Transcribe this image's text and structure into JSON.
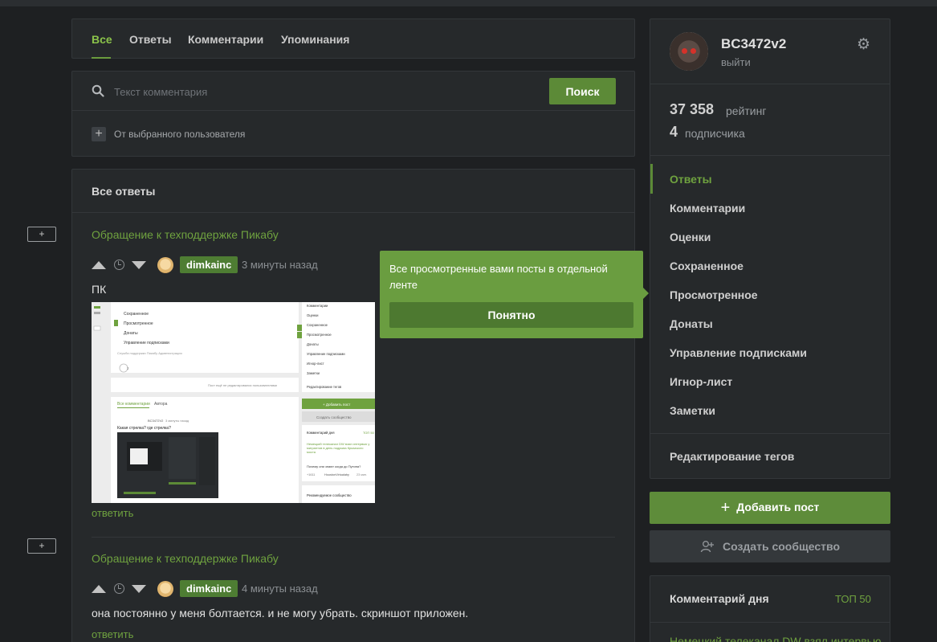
{
  "tabs": [
    {
      "label": "Все",
      "active": true
    },
    {
      "label": "Ответы"
    },
    {
      "label": "Комментарии"
    },
    {
      "label": "Упоминания"
    }
  ],
  "search": {
    "placeholder": "Текст комментария",
    "button": "Поиск",
    "from_user": "От выбранного пользователя"
  },
  "answers": {
    "heading": "Все ответы",
    "items": [
      {
        "title": "Обращение к техподдержке Пикабу",
        "user": "dimkainc",
        "time": "3 минуты назад",
        "text": "ПК",
        "has_image": true,
        "reply": "ответить"
      },
      {
        "title": "Обращение к техподдержке Пикабу",
        "user": "dimkainc",
        "time": "4 минуты назад",
        "text": "она постоянно у меня болтается. и не могу убрать. скриншот приложен.",
        "reply": "ответить"
      }
    ],
    "collapse_label": "+"
  },
  "screenshot_text": {
    "left_menu": [
      "Сохраненное",
      "Просмотренное",
      "Донаты",
      "Управление подписками"
    ],
    "footer": "Служба поддержки    Пикабу    Администрация",
    "count": "2",
    "not_edited": "Пост ещё не редактировался пользователями",
    "tabs": [
      "Все комментарии",
      "Автора"
    ],
    "user": "BC3472V2",
    "time": "3 минуты назад",
    "question": "Какая стрелка? где стрелка?",
    "right_menu": [
      "Комментарии",
      "Оценки",
      "Сохраненное",
      "Просмотренное",
      "Донаты",
      "Управление подписками",
      "Игнор-лист",
      "Заметки"
    ],
    "edit_tags": "Редактирование тегов",
    "add_post": "+ Добавить пост",
    "create_comm": "Создать сообщество",
    "cotd": "Комментарий дня",
    "cotd_top": "ТОП 50",
    "cotd_text": "Немецкий телеканал DW взял интервью у мигрантов в день подрыва Крымского моста",
    "cotd_q": "Почему они знают когда до Путина?",
    "cotd_author": "HoustonVirtualaby",
    "cotd_time": "23 мин.",
    "cotd_score": "+1611",
    "recommended": "Рекомендуемое сообщество"
  },
  "tooltip": {
    "text": "Все просмотренные вами посты в отдельной ленте",
    "button": "Понятно"
  },
  "profile": {
    "username": "BC3472v2",
    "logout": "выйти",
    "rating_value": "37 358",
    "rating_label": "рейтинг",
    "subs_value": "4",
    "subs_label": "подписчика",
    "menu": [
      {
        "label": "Ответы",
        "active": true
      },
      {
        "label": "Комментарии"
      },
      {
        "label": "Оценки"
      },
      {
        "label": "Сохраненное"
      },
      {
        "label": "Просмотренное"
      },
      {
        "label": "Донаты"
      },
      {
        "label": "Управление подписками"
      },
      {
        "label": "Игнор-лист"
      },
      {
        "label": "Заметки"
      }
    ],
    "edit_tags": "Редактирование тегов"
  },
  "actions": {
    "add_post": "Добавить пост",
    "create_community": "Создать сообщество"
  },
  "comment_of_day": {
    "title": "Комментарий дня",
    "top": "ТОП 50",
    "link": "Немецкий телеканал DW взял интервью"
  },
  "colors": {
    "accent": "#6fa23f",
    "button_green": "#5c8a37",
    "background": "#1e2022",
    "card": "#26292b"
  },
  "icons": {
    "search": "search-icon",
    "settings": "gear-icon",
    "add": "plus-icon",
    "community": "add-user-icon",
    "time": "clock-icon"
  }
}
